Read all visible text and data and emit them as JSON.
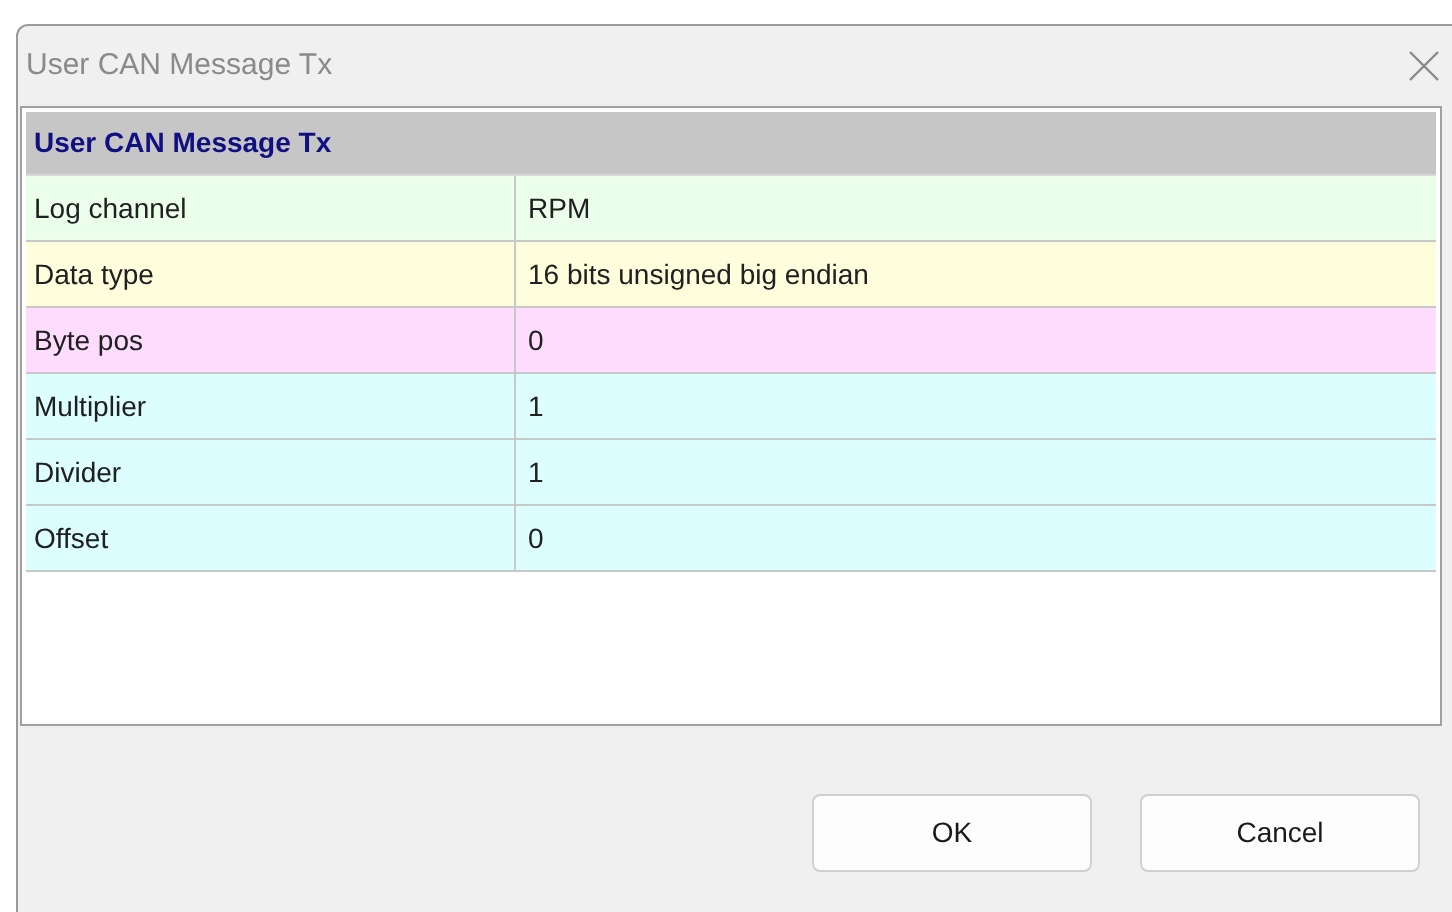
{
  "window": {
    "title": "User CAN Message Tx"
  },
  "grid": {
    "header": "User CAN Message Tx",
    "rows": [
      {
        "label": "Log channel",
        "value": "RPM",
        "color": "#eafeea"
      },
      {
        "label": "Data type",
        "value": "16 bits unsigned big endian",
        "color": "#fefedc"
      },
      {
        "label": "Byte pos",
        "value": "0",
        "color": "#fddcfd"
      },
      {
        "label": "Multiplier",
        "value": "1",
        "color": "#dcfefe"
      },
      {
        "label": "Divider",
        "value": "1",
        "color": "#dcfefe"
      },
      {
        "label": "Offset",
        "value": "0",
        "color": "#dcfefe"
      }
    ]
  },
  "buttons": [
    "OK",
    "Cancel"
  ]
}
